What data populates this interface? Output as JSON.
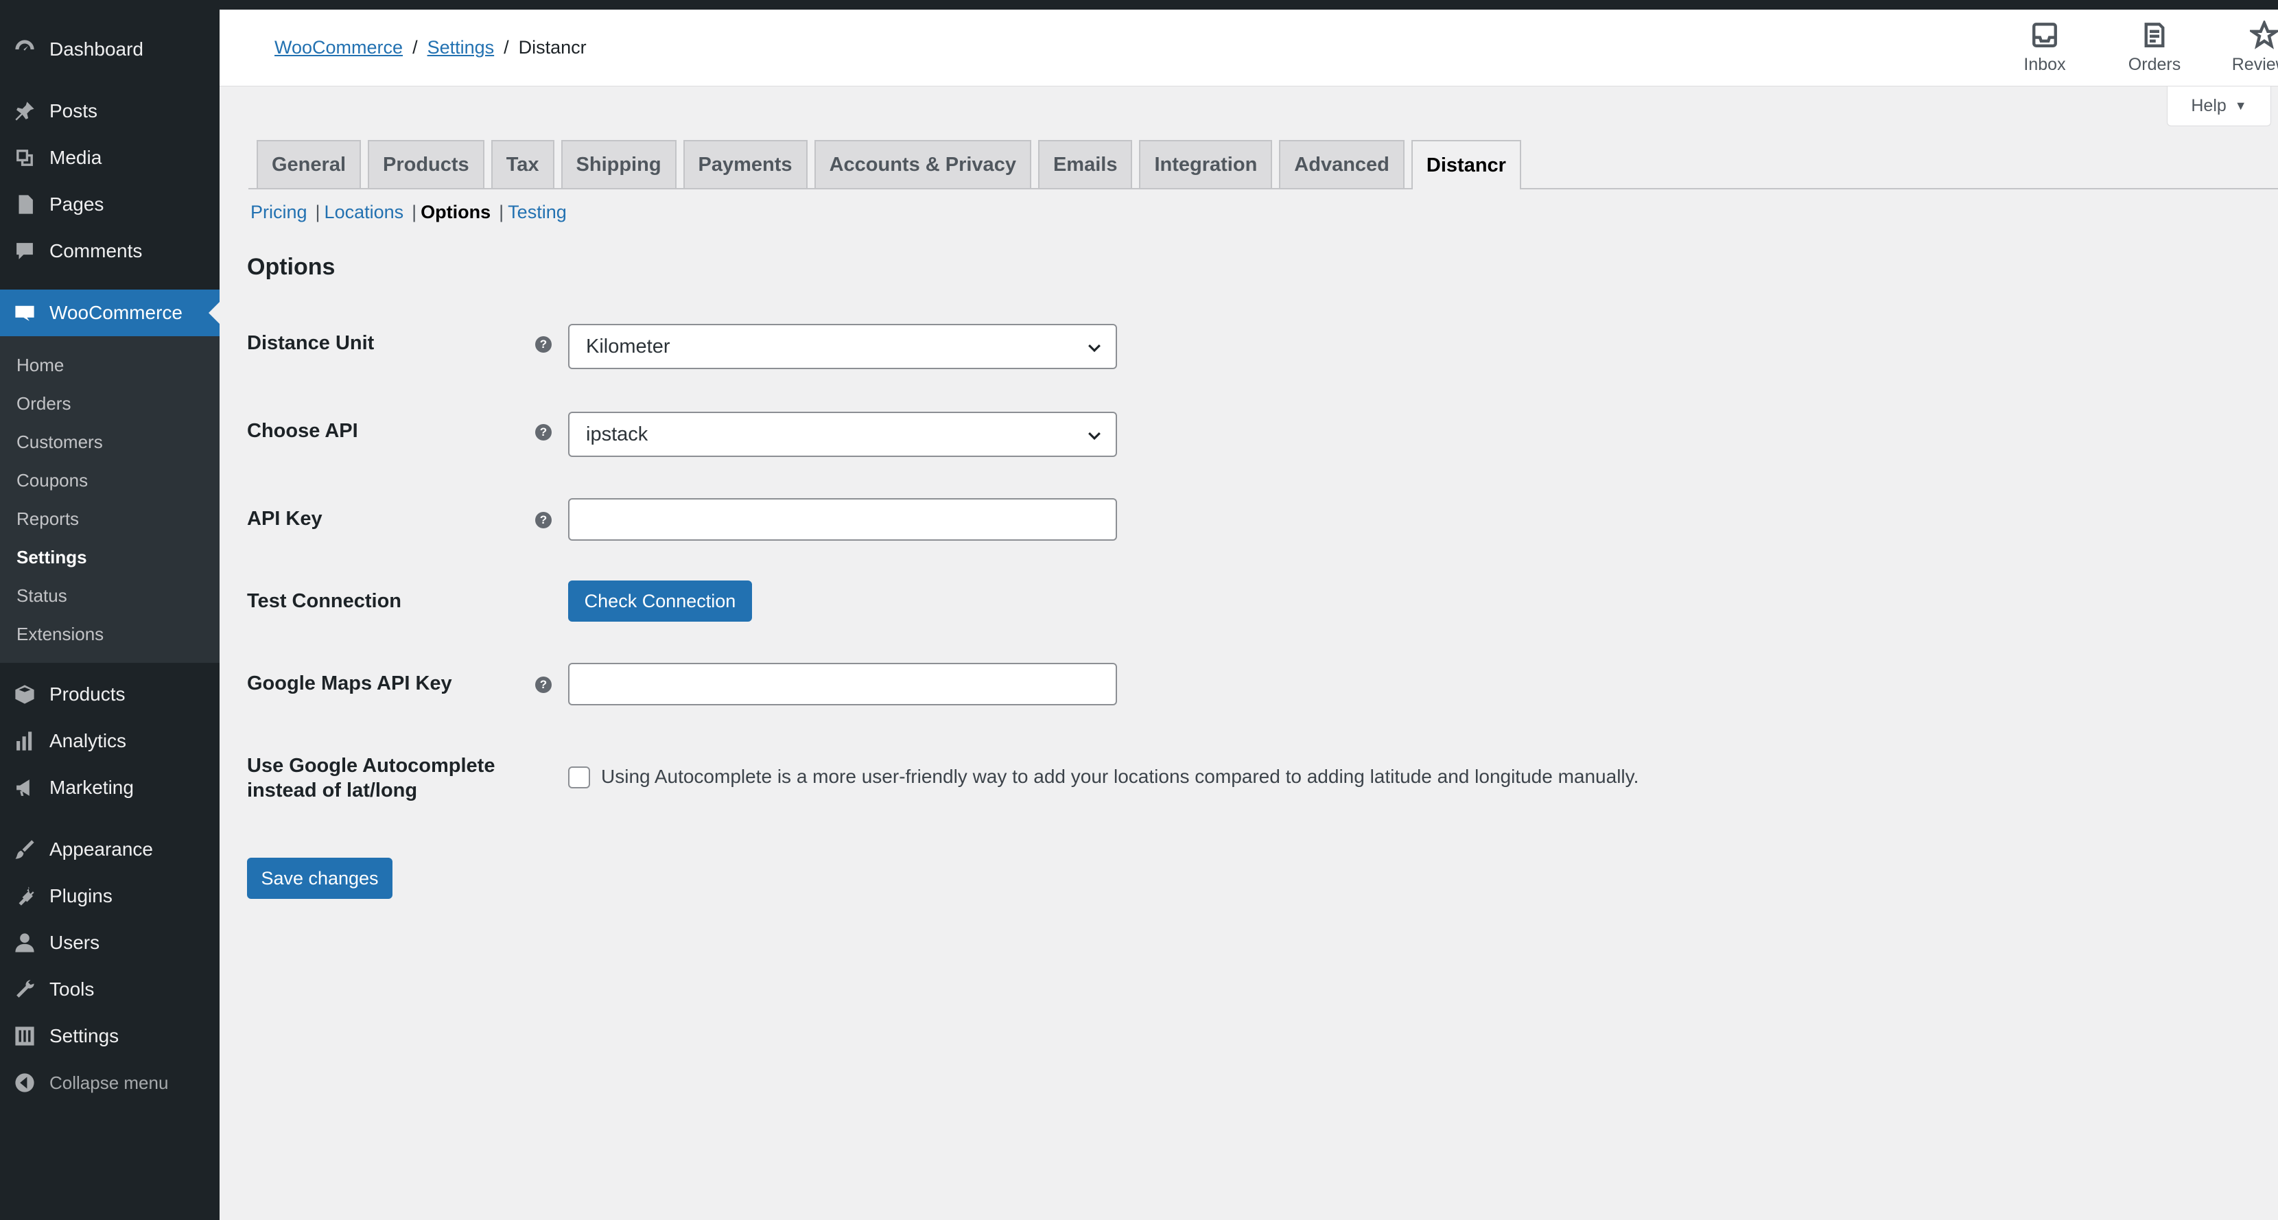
{
  "sidebar": {
    "items_top": [
      {
        "label": "Dashboard",
        "icon": "dashboard-icon"
      },
      {
        "label": "Posts",
        "icon": "pin-icon"
      },
      {
        "label": "Media",
        "icon": "media-icon"
      },
      {
        "label": "Pages",
        "icon": "pages-icon"
      },
      {
        "label": "Comments",
        "icon": "comment-icon"
      },
      {
        "label": "WooCommerce",
        "icon": "woo-icon"
      }
    ],
    "woo_submenu": [
      "Home",
      "Orders",
      "Customers",
      "Coupons",
      "Reports",
      "Settings",
      "Status",
      "Extensions"
    ],
    "items_bottom": [
      {
        "label": "Products",
        "icon": "box-icon"
      },
      {
        "label": "Analytics",
        "icon": "bar-chart-icon"
      },
      {
        "label": "Marketing",
        "icon": "megaphone-icon"
      },
      {
        "label": "Appearance",
        "icon": "brush-icon"
      },
      {
        "label": "Plugins",
        "icon": "plug-icon"
      },
      {
        "label": "Users",
        "icon": "user-icon"
      },
      {
        "label": "Tools",
        "icon": "wrench-icon"
      },
      {
        "label": "Settings",
        "icon": "sliders-icon"
      }
    ],
    "collapse_label": "Collapse menu"
  },
  "header": {
    "breadcrumb": [
      "WooCommerce",
      "Settings",
      "Distancr"
    ],
    "actions": [
      {
        "label": "Inbox",
        "icon": "inbox-icon"
      },
      {
        "label": "Orders",
        "icon": "orders-icon"
      },
      {
        "label": "Reviews",
        "icon": "star-icon"
      }
    ],
    "help_label": "Help"
  },
  "tabs": [
    "General",
    "Products",
    "Tax",
    "Shipping",
    "Payments",
    "Accounts & Privacy",
    "Emails",
    "Integration",
    "Advanced",
    "Distancr"
  ],
  "subsections": [
    "Pricing",
    "Locations",
    "Options",
    "Testing"
  ],
  "form": {
    "title": "Options",
    "distance_unit": {
      "label": "Distance Unit",
      "value": "Kilometer"
    },
    "choose_api": {
      "label": "Choose API",
      "value": "ipstack"
    },
    "api_key": {
      "label": "API Key",
      "value": ""
    },
    "test_connection": {
      "label": "Test Connection",
      "button": "Check Connection"
    },
    "google_maps_key": {
      "label": "Google Maps API Key",
      "value": ""
    },
    "autocomplete": {
      "label_line1": "Use Google Autocomplete",
      "label_line2": "instead of lat/long",
      "description": "Using Autocomplete is a more user-friendly way to add your locations compared to adding latitude and longitude manually.",
      "checked": false
    },
    "save_label": "Save changes"
  },
  "colors": {
    "accent": "#2271b1",
    "sidebar_bg": "#1d2327",
    "page_bg": "#f0f0f1"
  }
}
